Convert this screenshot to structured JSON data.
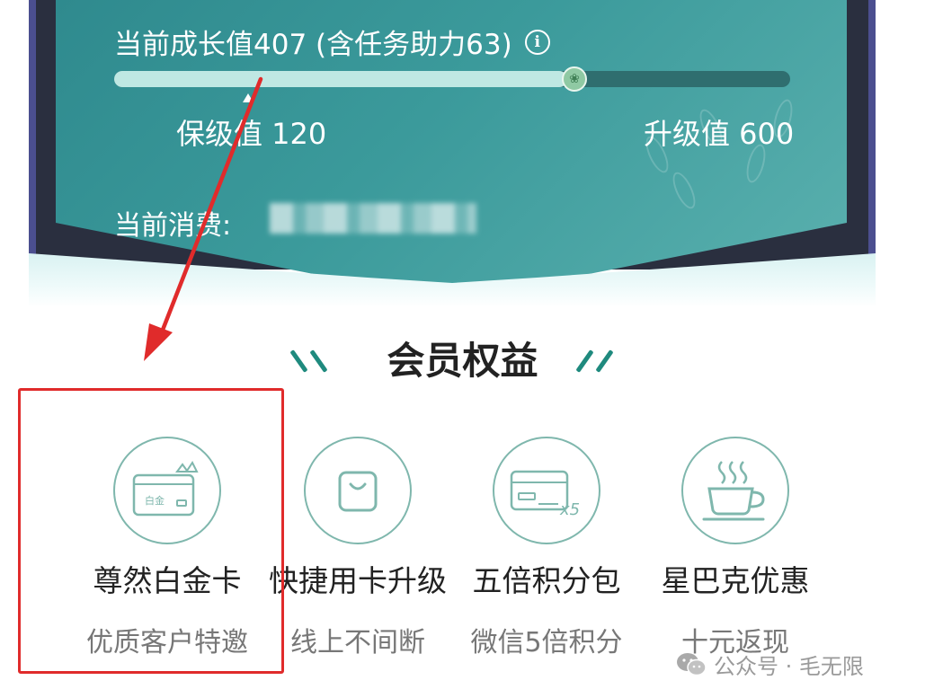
{
  "member_card": {
    "growth_text": "当前成长值407 (含任务助力63)",
    "info_icon": "info-icon",
    "progress_value": 0.67,
    "keep_label": "保级值 120",
    "upgrade_label": "升级值 600",
    "spend_label": "当前消费:"
  },
  "benefits": {
    "title": "会员权益",
    "items": [
      {
        "name": "尊然白金卡",
        "desc": "优质客户特邀",
        "icon": "platinum-card-icon",
        "card_text": "白金"
      },
      {
        "name": "快捷用卡升级",
        "desc": "线上不间断",
        "icon": "shopping-bag-icon"
      },
      {
        "name": "五倍积分包",
        "desc": "微信5倍积分",
        "icon": "card-x5-icon",
        "multiplier_text": "x5"
      },
      {
        "name": "星巴克优惠",
        "desc": "十元返现",
        "icon": "coffee-cup-icon"
      }
    ]
  },
  "watermark": {
    "text": "公众号 · 毛无限",
    "icon": "wechat-icon"
  },
  "colors": {
    "card_teal": "#3b9a9b",
    "accent_green": "#1f8a7e",
    "highlight_red": "#e02b2b",
    "icon_stroke": "#7fb7ad"
  }
}
